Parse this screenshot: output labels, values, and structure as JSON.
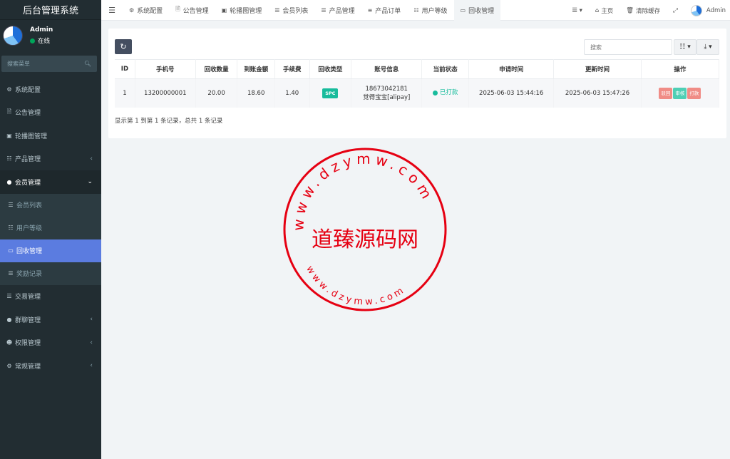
{
  "app": {
    "title": "后台管理系统"
  },
  "user": {
    "name": "Admin",
    "status": "在线"
  },
  "sidebar": {
    "search_placeholder": "搜索菜单",
    "items": [
      {
        "label": "系统配置",
        "icon": "gear-icon"
      },
      {
        "label": "公告管理",
        "icon": "document-icon"
      },
      {
        "label": "轮播图管理",
        "icon": "image-icon"
      },
      {
        "label": "产品管理",
        "icon": "grid-icon"
      },
      {
        "label": "会员管理",
        "icon": "user-icon"
      },
      {
        "label": "会员列表",
        "icon": "list-icon"
      },
      {
        "label": "用户等级",
        "icon": "sitemap-icon"
      },
      {
        "label": "回收管理",
        "icon": "card-icon"
      },
      {
        "label": "奖励记录",
        "icon": "list-icon"
      },
      {
        "label": "交易管理",
        "icon": "list-icon"
      },
      {
        "label": "群聊管理",
        "icon": "chat-icon"
      },
      {
        "label": "权限管理",
        "icon": "users-icon"
      },
      {
        "label": "常规管理",
        "icon": "cogs-icon"
      }
    ]
  },
  "topbar": {
    "tabs": [
      {
        "label": "系统配置",
        "icon": "gear-icon"
      },
      {
        "label": "公告管理",
        "icon": "document-icon"
      },
      {
        "label": "轮播图管理",
        "icon": "image-icon"
      },
      {
        "label": "会员列表",
        "icon": "list-icon"
      },
      {
        "label": "产品管理",
        "icon": "list-icon"
      },
      {
        "label": "产品订单",
        "icon": "list-icon"
      },
      {
        "label": "用户等级",
        "icon": "sitemap-icon"
      },
      {
        "label": "回收管理",
        "icon": "card-icon"
      }
    ],
    "home_label": "主页",
    "clear_cache_label": "清除缓存",
    "admin_label": "Admin"
  },
  "toolbar": {
    "search_placeholder": "搜索"
  },
  "table": {
    "headers": [
      "ID",
      "手机号",
      "回收数量",
      "到账金额",
      "手续费",
      "回收类型",
      "账号信息",
      "当前状态",
      "申请时间",
      "更新时间",
      "操作"
    ],
    "rows": [
      {
        "id": "1",
        "phone": "13200000001",
        "quantity": "20.00",
        "amount": "18.60",
        "fee": "1.40",
        "type": "SPC",
        "account_line1": "18673042181",
        "account_line2": "觉得宝宝[alipay]",
        "status": "已打款",
        "apply_time": "2025-06-03 15:44:16",
        "update_time": "2025-06-03 15:47:26",
        "ops": [
          "驳回",
          "审核",
          "打款"
        ]
      }
    ]
  },
  "pagination": {
    "summary": "显示第 1 到第 1 条记录，总共 1 条记录"
  },
  "watermark": {
    "text": "道臻源码网",
    "url_top": "www.dzymw.com",
    "url_bottom": "www.dzymw.com"
  },
  "colors": {
    "sidebar_bg": "#222d32",
    "active_item": "#5b7ce0",
    "success": "#18bc9c",
    "danger_btn": "#f08c86",
    "stamp_red": "#e60012"
  }
}
